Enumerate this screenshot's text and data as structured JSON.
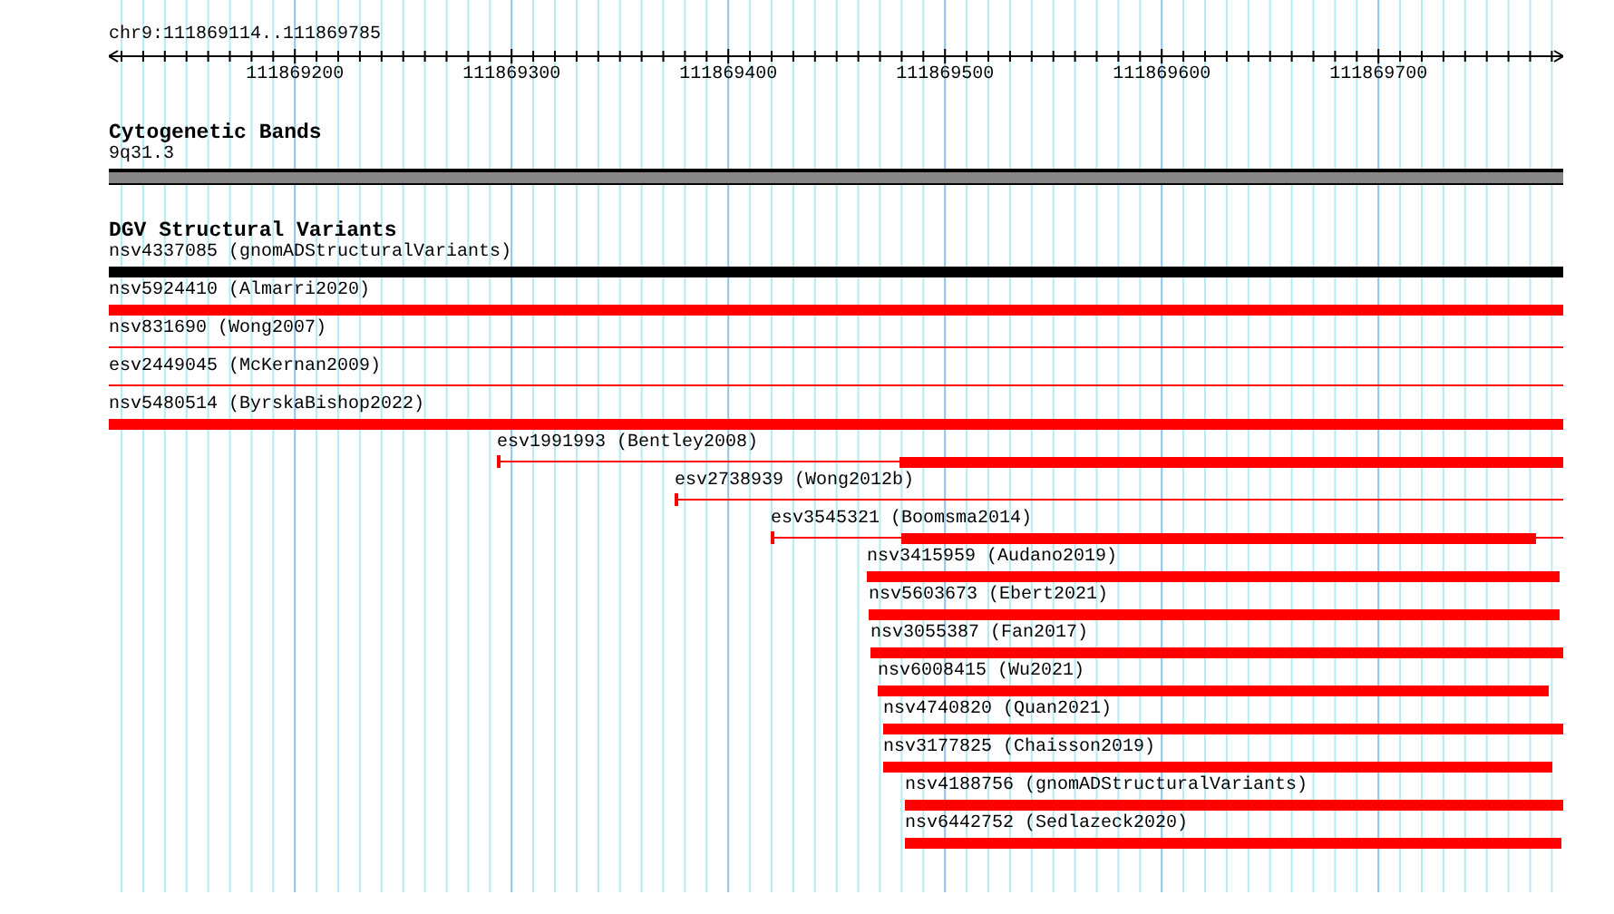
{
  "ruler": {
    "title": "chr9:111869114..111869785",
    "ticks": [
      "111869200",
      "111869300",
      "111869400",
      "111869500",
      "111869600",
      "111869700"
    ]
  },
  "cytoband_track": {
    "title": "Cytogenetic Bands",
    "band": "9q31.3"
  },
  "variant_track": {
    "title": "DGV Structural Variants",
    "features": [
      {
        "label": "nsv4337085 (gnomADStructuralVariants)",
        "color": "#000000",
        "start_cap": false
      },
      {
        "label": "nsv5924410 (Almarri2020)",
        "color": "#ff0000",
        "start_cap": false
      },
      {
        "label": "nsv831690 (Wong2007)",
        "color": "#ff0000",
        "start_cap": false
      },
      {
        "label": "esv2449045 (McKernan2009)",
        "color": "#ff0000",
        "start_cap": false
      },
      {
        "label": "nsv5480514 (ByrskaBishop2022)",
        "color": "#ff0000",
        "start_cap": false
      },
      {
        "label": "esv1991993 (Bentley2008)",
        "color": "#ff0000",
        "start_cap": true
      },
      {
        "label": "esv2738939 (Wong2012b)",
        "color": "#ff0000",
        "start_cap": true
      },
      {
        "label": "esv3545321 (Boomsma2014)",
        "color": "#ff0000",
        "start_cap": true
      },
      {
        "label": "nsv3415959 (Audano2019)",
        "color": "#ff0000",
        "start_cap": false
      },
      {
        "label": "nsv5603673 (Ebert2021)",
        "color": "#ff0000",
        "start_cap": false
      },
      {
        "label": "nsv3055387 (Fan2017)",
        "color": "#ff0000",
        "start_cap": false
      },
      {
        "label": "nsv6008415 (Wu2021)",
        "color": "#ff0000",
        "start_cap": false
      },
      {
        "label": "nsv4740820 (Quan2021)",
        "color": "#ff0000",
        "start_cap": false
      },
      {
        "label": "nsv3177825 (Chaisson2019)",
        "color": "#ff0000",
        "start_cap": false
      },
      {
        "label": "nsv4188756 (gnomADStructuralVariants)",
        "color": "#ff0000",
        "start_cap": false
      },
      {
        "label": "nsv6442752 (Sedlazeck2020)",
        "color": "#ff0000",
        "start_cap": false
      }
    ]
  }
}
